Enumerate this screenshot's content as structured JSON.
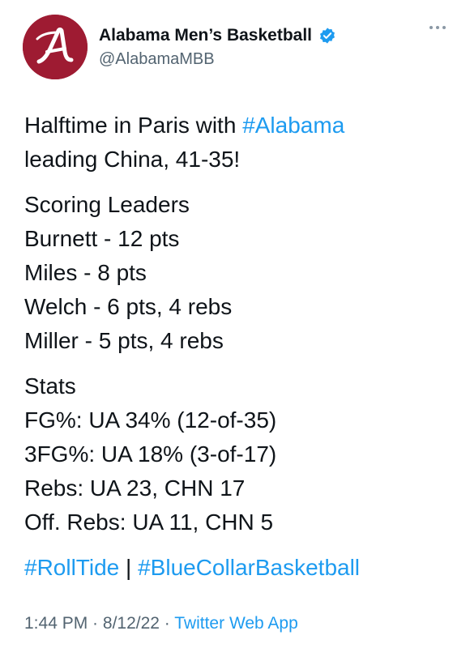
{
  "author": {
    "display_name": "Alabama Men’s Basketball",
    "handle": "@AlabamaMBB",
    "avatar_letter": "A",
    "brand_color": "#9e1b32",
    "verified_color": "#1d9bf0",
    "more_icon": "more-horizontal-icon"
  },
  "tweet": {
    "intro": {
      "part1": "Halftime in Paris with ",
      "hashtag": "#Alabama",
      "part2": " leading China, 41-35!"
    },
    "scoring": {
      "heading": "Scoring Leaders",
      "lines": [
        "Burnett - 12 pts",
        "Miles - 8 pts",
        "Welch - 6 pts, 4 rebs",
        "Miller - 5 pts, 4 rebs"
      ]
    },
    "stats": {
      "heading": "Stats",
      "lines": [
        "FG%: UA 34% (12-of-35)",
        "3FG%: UA 18% (3-of-17)",
        "Rebs: UA 23, CHN 17",
        "Off. Rebs: UA 11, CHN 5"
      ]
    },
    "hashtags": {
      "first": "#RollTide",
      "separator": " | ",
      "second": "#BlueCollarBasketball"
    }
  },
  "meta": {
    "time": "1:44 PM",
    "dot": " · ",
    "date": "8/12/22",
    "source": "Twitter Web App"
  }
}
